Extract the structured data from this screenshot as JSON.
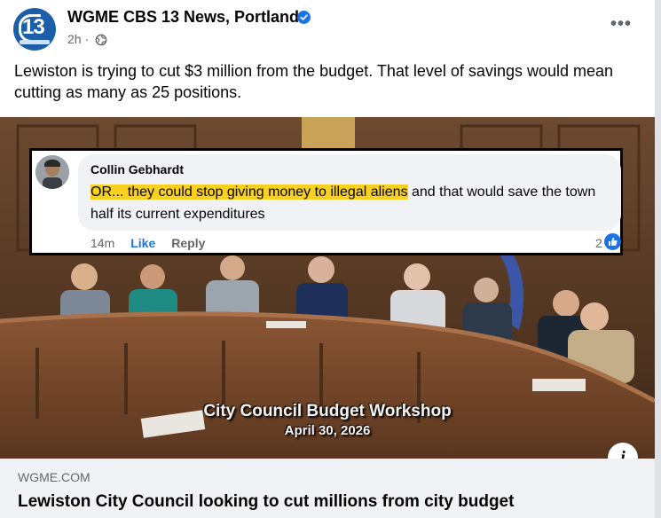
{
  "post": {
    "page_name": "WGME CBS 13 News, Portland",
    "time": "2h ·",
    "caption": "Lewiston is trying to cut $3 million from the budget. That level of savings would mean cutting as many as 25 positions.",
    "avatar_text": "13",
    "more_label": "•••"
  },
  "image": {
    "overlay_title": "City Council Budget Workshop",
    "overlay_date": "April 30, 2026"
  },
  "comment": {
    "author": "Collin Gebhardt",
    "highlighted_text": "OR... they could stop giving money to illegal aliens",
    "rest_text": " and that would save the town half its current expenditures",
    "time": "14m",
    "like_label": "Like",
    "reply_label": "Reply",
    "reaction_count": "2"
  },
  "link": {
    "domain": "WGME.COM",
    "headline": "Lewiston City Council looking to cut millions from city budget",
    "info_label": "i"
  },
  "colors": {
    "accent": "#1b74e4",
    "highlight": "#f7d11e",
    "secondary_text": "#65676b"
  },
  "icons": [
    "verified-badge-icon",
    "globe-icon",
    "more-options-icon",
    "like-thumb-icon",
    "info-icon"
  ]
}
